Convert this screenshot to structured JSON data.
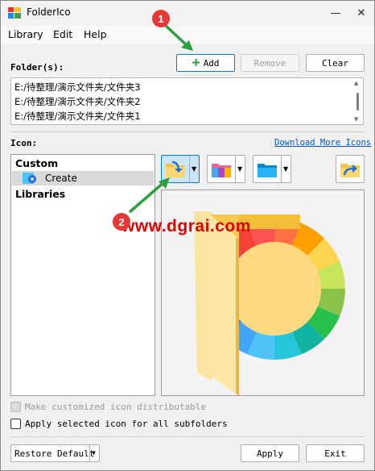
{
  "window": {
    "title": "FolderIco",
    "minimize_glyph": "—",
    "close_glyph": "✕"
  },
  "menu": [
    "Library",
    "Edit",
    "Help"
  ],
  "folders": {
    "label": "Folder(s):",
    "add_label": "Add",
    "remove_label": "Remove",
    "clear_label": "Clear",
    "items": [
      "E:/待整理/演示文件夹/文件夹3",
      "E:/待整理/演示文件夹/文件夹2",
      "E:/待整理/演示文件夹/文件夹1"
    ]
  },
  "icon_section": {
    "label": "Icon:",
    "download_link": "Download More Icons",
    "tree": {
      "custom": "Custom",
      "create": "Create",
      "libraries": "Libraries"
    },
    "toolbar_icons": [
      "folder-import-icon",
      "palette-folder-icon",
      "blue-folder-icon",
      "folder-export-icon"
    ]
  },
  "watermark": "www.dgrai.com",
  "annotations": {
    "marker_1": "1",
    "marker_2": "2"
  },
  "options": {
    "distributable_label": "Make customized icon distributable",
    "distributable_checked": true,
    "distributable_enabled": false,
    "subfolders_label": "Apply selected icon for all subfolders",
    "subfolders_checked": false
  },
  "footer": {
    "restore_label": "Restore Default",
    "apply_label": "Apply",
    "exit_label": "Exit"
  },
  "colors": {
    "accent": "#0078d7",
    "marker": "#e53935",
    "arrow": "#2e9e3e",
    "watermark": "#e00000",
    "link": "#0055cc"
  }
}
